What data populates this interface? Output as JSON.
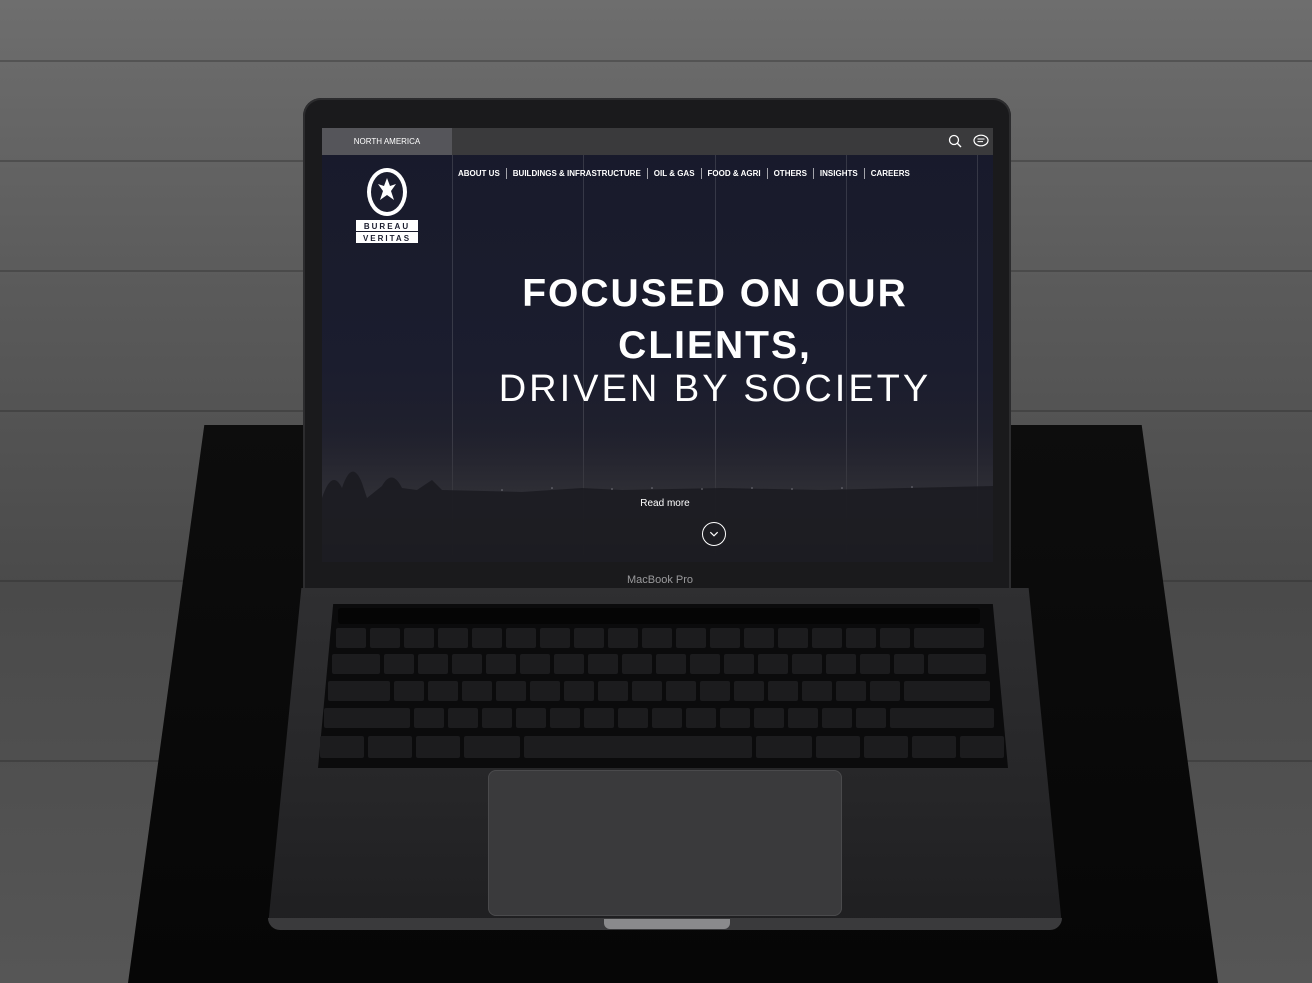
{
  "site": {
    "region": "NORTH AMERICA",
    "logo_alt": "BUREAU VERITAS 1828",
    "nav": [
      "ABOUT US",
      "BUILDINGS & INFRASTRUCTURE",
      "OIL & GAS",
      "FOOD & AGRI",
      "OTHERS",
      "INSIGHTS",
      "CAREERS"
    ],
    "hero_line1": "FOCUSED ON OUR",
    "hero_line2": "CLIENTS,",
    "hero_line3": "DRIVEN BY SOCIETY",
    "read_more": "Read more",
    "icons": [
      "search-icon",
      "chat-icon",
      "chevron-down-icon"
    ]
  },
  "device": {
    "brand_label": "MacBook Pro"
  },
  "colors": {
    "screen_bg": "#1b1d2e",
    "topbar": "#3a3a3c",
    "region_tab": "#55555a",
    "text": "#ffffff"
  }
}
